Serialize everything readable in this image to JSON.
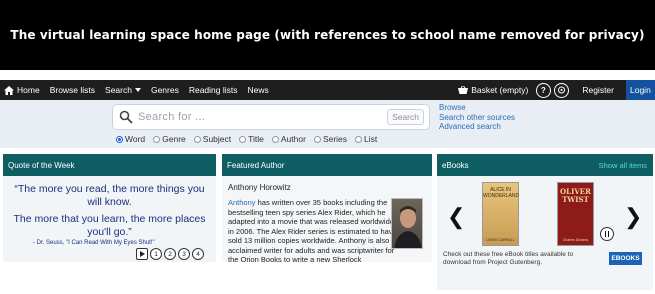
{
  "banner": {
    "text": "The virtual learning space home page (with references to school name removed for privacy)"
  },
  "nav": {
    "items": [
      {
        "label": "Home",
        "icon": "home-icon"
      },
      {
        "label": "Browse lists"
      },
      {
        "label": "Search",
        "has_dropdown": true
      },
      {
        "label": "Genres"
      },
      {
        "label": "Reading lists"
      },
      {
        "label": "News"
      }
    ],
    "basket": "Basket (empty)",
    "help_glyph": "?",
    "register": "Register",
    "login": "Login"
  },
  "search": {
    "placeholder": "Search for ...",
    "button": "Search",
    "links": [
      "Browse",
      "Search other sources",
      "Advanced search"
    ],
    "scopes": [
      "Word",
      "Genre",
      "Subject",
      "Title",
      "Author",
      "Series",
      "List"
    ],
    "selected_scope": "Word"
  },
  "quote_panel": {
    "title": "Quote of the Week",
    "line1": "“The more you read, the more things you will know.",
    "line2": "The more that you learn, the more places you'll go.”",
    "attribution": "- Dr. Seuss, \"I Can Read With My Eyes Shut!\"",
    "pages": [
      "1",
      "2",
      "3",
      "4"
    ]
  },
  "author_panel": {
    "title": "Featured Author",
    "name": "Anthony Horowitz",
    "link_word": "Anthony",
    "bio": " has written over 35 books including the bestselling teen spy series Alex Rider, which he adapted into a movie that was released worldwide in 2006. The Alex Rider series is estimated to have sold 13 million copies worldwide. Anthony is also an acclaimed writer for adults and was scriptwriter for the Orion Books to write a new Sherlock"
  },
  "ebooks_panel": {
    "title": "eBooks",
    "show_all": "Show all items",
    "books": [
      {
        "title": "ALICE IN WONDERLAND",
        "author": "LEWIS CARROLL"
      },
      {
        "title": "OLIVER TWIST",
        "author": "Charles Dickens"
      }
    ],
    "description": "Check out these free eBook titles available to download from Project Gutenberg.",
    "logo": "EBOOKS"
  }
}
